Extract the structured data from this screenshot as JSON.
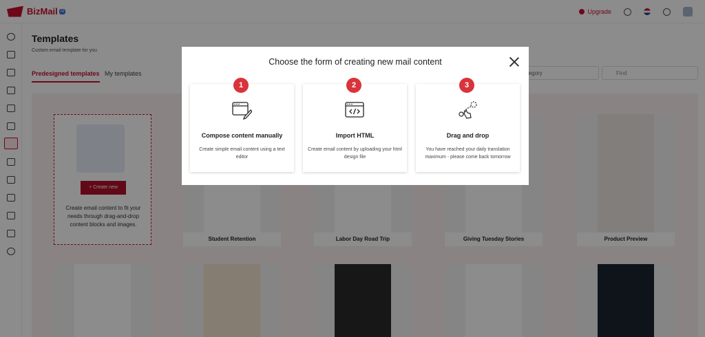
{
  "brand": {
    "name": "BizMail",
    "badge": "AI"
  },
  "topbar": {
    "upgrade_label": "Upgrade"
  },
  "page": {
    "title": "Templates",
    "subtitle": "Custom email template for you",
    "tabs": [
      {
        "label": "Predesigned templates",
        "active": true
      },
      {
        "label": "My templates",
        "active": false
      }
    ],
    "category_placeholder": "ategory",
    "search_placeholder": "Find"
  },
  "create_card": {
    "button_label": "+ Create new",
    "description": "Create email content to fit your needs through drag-and-drop content blocks and images."
  },
  "templates": [
    {
      "name": "Student Retention"
    },
    {
      "name": "Labor Day Road Trip"
    },
    {
      "name": "Giving Tuesday Stories"
    },
    {
      "name": "Product Preview"
    }
  ],
  "modal": {
    "title": "Choose the form of creating new mail content",
    "options": [
      {
        "number": "1",
        "icon": "compose-edit-icon",
        "title": "Compose content manually",
        "description": "Create simple email content using a text editor"
      },
      {
        "number": "2",
        "icon": "code-window-icon",
        "title": "Import HTML",
        "description": "Create email content by uploading your html design file"
      },
      {
        "number": "3",
        "icon": "drag-drop-hand-icon",
        "title": "Drag and drop",
        "description": "You have reached your daily translation maximum - please come back tomorrow"
      }
    ]
  },
  "colors": {
    "accent": "#c8102e",
    "badge_red": "#d9343b"
  }
}
